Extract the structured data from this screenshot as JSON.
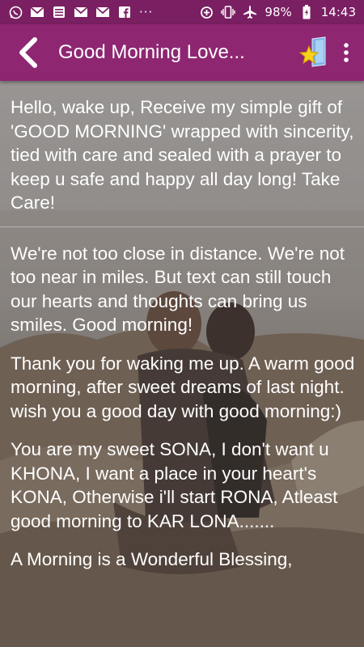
{
  "status_bar": {
    "battery": "98%",
    "time": "14:43",
    "overflow_dots": "···"
  },
  "app_bar": {
    "title": "Good Morning Love..."
  },
  "messages": [
    "Hello, wake up, Receive my simple gift of 'GOOD MORNING' wrapped with sincerity, tied with care and sealed with a prayer to keep u safe and happy all day long! Take Care!",
    "We're not too close in distance. We're not too near in miles. But text can still touch our hearts and thoughts can bring us smiles. Good morning!",
    "Thank you for waking me up. A warm good morning, after sweet dreams of last night. wish you a good day with good morning:)",
    "You are my sweet SONA, I don't want u KHONA, I want a place in your heart's KONA, Otherwise i'll start RONA, Atleast good morning to KAR LONA.......",
    "A Morning is a Wonderful Blessing,"
  ],
  "colors": {
    "status_bar": "#7a1f62",
    "app_bar": "#8e2672",
    "text": "#ffffff"
  },
  "icons": [
    "whatsapp-icon",
    "gmail-icon",
    "news-icon",
    "gmail-icon",
    "gmail-icon",
    "facebook-icon",
    "data-saver-icon",
    "vibrate-icon",
    "airplane-icon",
    "battery-icon",
    "back-arrow-icon",
    "star-icon",
    "more-vert-icon"
  ]
}
